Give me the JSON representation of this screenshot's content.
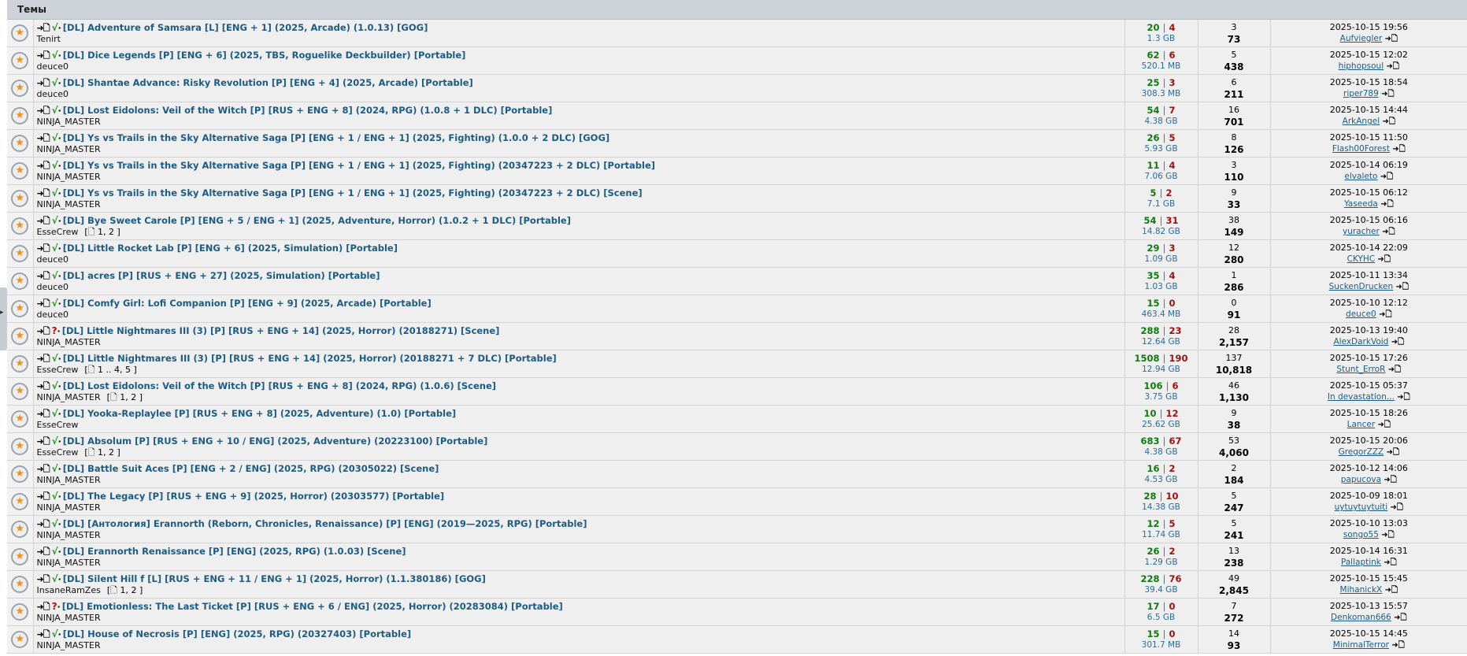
{
  "section": {
    "title": "Темы"
  },
  "topics": [
    {
      "status": "√",
      "status_type": "ok",
      "title": "[DL] Adventure of Samsara [L] [ENG + 1] (2025, Arcade) (1.0.13) [GOG]",
      "author": "Tenirt",
      "pages": null,
      "seeds": "20",
      "leechs": "4",
      "size": "1.3 GB",
      "replies": "3",
      "views": "73",
      "last_date": "2025-10-15 19:56",
      "last_user": "Aufviegler"
    },
    {
      "status": "√",
      "status_type": "ok",
      "title": "[DL] Dice Legends [P] [ENG + 6] (2025, TBS, Roguelike Deckbuilder) [Portable]",
      "author": "deuce0",
      "pages": null,
      "seeds": "62",
      "leechs": "6",
      "size": "520.1 MB",
      "replies": "5",
      "views": "438",
      "last_date": "2025-10-15 12:02",
      "last_user": "hiphopsoul"
    },
    {
      "status": "√",
      "status_type": "ok",
      "title": "[DL] Shantae Advance: Risky Revolution [P] [ENG + 4] (2025, Arcade) [Portable]",
      "author": "deuce0",
      "pages": null,
      "seeds": "25",
      "leechs": "3",
      "size": "308.3 MB",
      "replies": "6",
      "views": "211",
      "last_date": "2025-10-15 18:54",
      "last_user": "riper789"
    },
    {
      "status": "√",
      "status_type": "ok",
      "title": "[DL] Lost Eidolons: Veil of the Witch [P] [RUS + ENG + 8] (2024, RPG) (1.0.8 + 1 DLC) [Portable]",
      "author": "NINJA_MASTER",
      "pages": null,
      "seeds": "54",
      "leechs": "7",
      "size": "4.38 GB",
      "replies": "16",
      "views": "701",
      "last_date": "2025-10-15 14:44",
      "last_user": "ArkAngel"
    },
    {
      "status": "√",
      "status_type": "ok",
      "title": "[DL] Ys vs Trails in the Sky Alternative Saga [P] [ENG + 1 / ENG + 1] (2025, Fighting) (1.0.0 + 2 DLC) [GOG]",
      "author": "NINJA_MASTER",
      "pages": null,
      "seeds": "26",
      "leechs": "5",
      "size": "5.93 GB",
      "replies": "8",
      "views": "126",
      "last_date": "2025-10-15 11:50",
      "last_user": "Flash00Forest"
    },
    {
      "status": "√",
      "status_type": "ok",
      "title": "[DL] Ys vs Trails in the Sky Alternative Saga [P] [ENG + 1 / ENG + 1] (2025, Fighting) (20347223 + 2 DLC) [Portable]",
      "author": "NINJA_MASTER",
      "pages": null,
      "seeds": "11",
      "leechs": "4",
      "size": "7.06 GB",
      "replies": "3",
      "views": "110",
      "last_date": "2025-10-14 06:19",
      "last_user": "elvaleto"
    },
    {
      "status": "√",
      "status_type": "ok",
      "title": "[DL] Ys vs Trails in the Sky Alternative Saga [P] [ENG + 1 / ENG + 1] (2025, Fighting) (20347223 + 2 DLC) [Scene]",
      "author": "NINJA_MASTER",
      "pages": null,
      "seeds": "5",
      "leechs": "2",
      "size": "7.1 GB",
      "replies": "9",
      "views": "33",
      "last_date": "2025-10-15 06:12",
      "last_user": "Yaseeda"
    },
    {
      "status": "√",
      "status_type": "ok",
      "title": "[DL] Bye Sweet Carole [P] [ENG + 5 / ENG + 1] (2025, Adventure, Horror) (1.0.2 + 1 DLC) [Portable]",
      "author": "EsseCrew",
      "pages": "[🗋 1, 2 ]",
      "seeds": "54",
      "leechs": "31",
      "size": "14.82 GB",
      "replies": "38",
      "views": "149",
      "last_date": "2025-10-15 06:16",
      "last_user": "yuracher"
    },
    {
      "status": "√",
      "status_type": "ok",
      "title": "[DL] Little Rocket Lab [P] [ENG + 6] (2025, Simulation) [Portable]",
      "author": "deuce0",
      "pages": null,
      "seeds": "29",
      "leechs": "3",
      "size": "1.09 GB",
      "replies": "12",
      "views": "280",
      "last_date": "2025-10-14 22:09",
      "last_user": "CKYHC"
    },
    {
      "status": "√",
      "status_type": "ok",
      "title": "[DL] acres [P] [RUS + ENG + 27] (2025, Simulation) [Portable]",
      "author": "deuce0",
      "pages": null,
      "seeds": "35",
      "leechs": "4",
      "size": "1.03 GB",
      "replies": "1",
      "views": "286",
      "last_date": "2025-10-11 13:34",
      "last_user": "SuckenDrucken"
    },
    {
      "status": "√",
      "status_type": "ok",
      "title": "[DL] Comfy Girl: Lofi Companion [P] [ENG + 9] (2025, Arcade) [Portable]",
      "author": "deuce0",
      "pages": null,
      "seeds": "15",
      "leechs": "0",
      "size": "463.4 MB",
      "replies": "0",
      "views": "91",
      "last_date": "2025-10-10 12:12",
      "last_user": "deuce0"
    },
    {
      "status": "?",
      "status_type": "q",
      "title": "[DL] Little Nightmares III (3) [P] [RUS + ENG + 14] (2025, Horror) (20188271) [Scene]",
      "author": "NINJA_MASTER",
      "pages": null,
      "seeds": "288",
      "leechs": "23",
      "size": "12.64 GB",
      "replies": "28",
      "views": "2,157",
      "last_date": "2025-10-13 19:40",
      "last_user": "AlexDarkVoid"
    },
    {
      "status": "√",
      "status_type": "ok",
      "title": "[DL] Little Nightmares III (3) [P] [RUS + ENG + 14] (2025, Horror) (20188271 + 7 DLC) [Portable]",
      "author": "EsseCrew",
      "pages": "[🗋 1 .. 4, 5 ]",
      "seeds": "1508",
      "leechs": "190",
      "size": "12.94 GB",
      "replies": "137",
      "views": "10,818",
      "last_date": "2025-10-15 17:26",
      "last_user": "Stunt_ErroR"
    },
    {
      "status": "√",
      "status_type": "ok",
      "title": "[DL] Lost Eidolons: Veil of the Witch [P] [RUS + ENG + 8] (2024, RPG) (1.0.6) [Scene]",
      "author": "NINJA_MASTER",
      "pages": "[🗋 1, 2 ]",
      "seeds": "106",
      "leechs": "6",
      "size": "3.75 GB",
      "replies": "46",
      "views": "1,130",
      "last_date": "2025-10-15 05:37",
      "last_user": "In devastation..."
    },
    {
      "status": "√",
      "status_type": "ok",
      "title": "[DL] Yooka-Replaylee [P] [RUS + ENG + 8] (2025, Adventure) (1.0) [Portable]",
      "author": "EsseCrew",
      "pages": null,
      "seeds": "10",
      "leechs": "12",
      "size": "25.62 GB",
      "replies": "9",
      "views": "38",
      "last_date": "2025-10-15 18:26",
      "last_user": "Lancer"
    },
    {
      "status": "√",
      "status_type": "ok",
      "title": "[DL] Absolum [P] [RUS + ENG + 10 / ENG] (2025, Adventure) (20223100) [Portable]",
      "author": "EsseCrew",
      "pages": "[🗋 1, 2 ]",
      "seeds": "683",
      "leechs": "67",
      "size": "4.38 GB",
      "replies": "53",
      "views": "4,060",
      "last_date": "2025-10-15 20:06",
      "last_user": "GregorZZZ"
    },
    {
      "status": "√",
      "status_type": "ok",
      "title": "[DL] Battle Suit Aces [P] [ENG + 2 / ENG] (2025, RPG) (20305022) [Scene]",
      "author": "NINJA_MASTER",
      "pages": null,
      "seeds": "16",
      "leechs": "2",
      "size": "4.53 GB",
      "replies": "2",
      "views": "184",
      "last_date": "2025-10-12 14:06",
      "last_user": "papucova"
    },
    {
      "status": "√",
      "status_type": "ok",
      "title": "[DL] The Legacy [P] [RUS + ENG + 9] (2025, Horror) (20303577) [Portable]",
      "author": "NINJA_MASTER",
      "pages": null,
      "seeds": "28",
      "leechs": "10",
      "size": "14.38 GB",
      "replies": "5",
      "views": "247",
      "last_date": "2025-10-09 18:01",
      "last_user": "uytuytuytuiti"
    },
    {
      "status": "√",
      "status_type": "ok",
      "title": "[DL] [Антология] Erannorth (Reborn, Chronicles, Renaissance) [P] [ENG] (2019—2025, RPG) [Portable]",
      "author": "NINJA_MASTER",
      "pages": null,
      "seeds": "12",
      "leechs": "5",
      "size": "11.74 GB",
      "replies": "5",
      "views": "241",
      "last_date": "2025-10-10 13:03",
      "last_user": "songo55"
    },
    {
      "status": "√",
      "status_type": "ok",
      "title": "[DL] Erannorth Renaissance [P] [ENG] (2025, RPG) (1.0.03) [Scene]",
      "author": "NINJA_MASTER",
      "pages": null,
      "seeds": "26",
      "leechs": "2",
      "size": "1.29 GB",
      "replies": "13",
      "views": "238",
      "last_date": "2025-10-14 16:31",
      "last_user": "Pallaptink"
    },
    {
      "status": "√",
      "status_type": "ok",
      "title": "[DL] Silent Hill f [L] [RUS + ENG + 11 / ENG + 1] (2025, Horror) (1.1.380186) [GOG]",
      "author": "InsaneRamZes",
      "pages": "[🗋 1, 2 ]",
      "seeds": "228",
      "leechs": "76",
      "size": "39.4 GB",
      "replies": "49",
      "views": "2,845",
      "last_date": "2025-10-15 15:45",
      "last_user": "MihanickX"
    },
    {
      "status": "?",
      "status_type": "q",
      "title": "[DL] Emotionless: The Last Ticket [P] [RUS + ENG + 6 / ENG] (2025, Horror) (20283084) [Portable]",
      "author": "NINJA_MASTER",
      "pages": null,
      "seeds": "17",
      "leechs": "0",
      "size": "6.5 GB",
      "replies": "7",
      "views": "272",
      "last_date": "2025-10-13 15:57",
      "last_user": "Denkoman666"
    },
    {
      "status": "√",
      "status_type": "ok",
      "title": "[DL] House of Necrosis [P] [ENG] (2025, RPG) (20327403) [Portable]",
      "author": "NINJA_MASTER",
      "pages": null,
      "seeds": "15",
      "leechs": "0",
      "size": "301.7 MB",
      "replies": "14",
      "views": "93",
      "last_date": "2025-10-15 14:45",
      "last_user": "MinimalTerror"
    }
  ],
  "icons": {
    "topic_icon": "star-circle-icon",
    "download_icon": "arrow-doc-icon",
    "pages_icon": "page-icon",
    "goto_icon": "goto-latest-icon",
    "collapse_icon": "chevron-right-icon"
  },
  "colors": {
    "header_bg": "#cdd3d9",
    "row_bg": "#efefef",
    "title_link": "#1d5c82",
    "seed_green": "#0f7a0f",
    "leech_red": "#a01010",
    "status_ok": "#1a8b1a",
    "status_question": "#d40000",
    "star_orange": "#f29018"
  }
}
